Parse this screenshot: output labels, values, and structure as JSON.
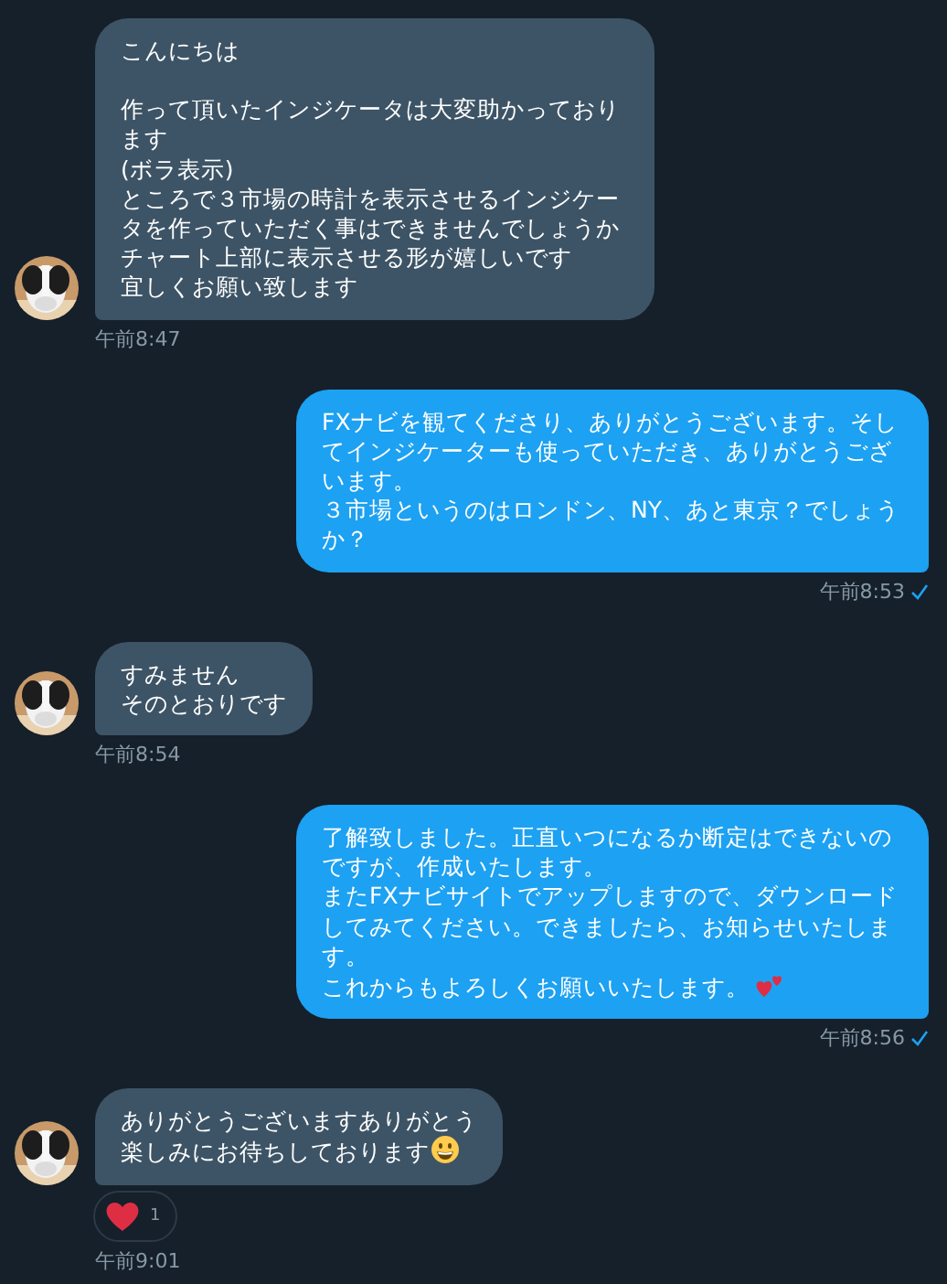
{
  "messages": [
    {
      "kind": "incoming",
      "paragraphs": [
        {
          "text": "こんにちは",
          "blank_after": true
        },
        {
          "text": "作って頂いたインジケータは大変助かっております"
        },
        {
          "text": "(ボラ表示)"
        },
        {
          "text": "ところで３市場の時計を表示させるインジケータを作っていただく事はできませんでしょうか"
        },
        {
          "text": "チャート上部に表示させる形が嬉しいです"
        },
        {
          "text": "宜しくお願い致します"
        }
      ],
      "time": "午前8:47",
      "avatar": {
        "kind": "picture"
      }
    },
    {
      "kind": "outgoing",
      "paragraphs": [
        {
          "text": "FXナビを観てくださり、ありがとうございます。そしてインジケーターも使っていただき、ありがとうございます。"
        },
        {
          "text": "３市場というのはロンドン、NY、あと東京？でしょうか？"
        }
      ],
      "time": "午前8:53",
      "read": true
    },
    {
      "kind": "incoming",
      "paragraphs": [
        {
          "text": "すみません"
        },
        {
          "text": "そのとおりです"
        }
      ],
      "time": "午前8:54",
      "avatar": {
        "kind": "picture"
      }
    },
    {
      "kind": "outgoing",
      "paragraphs": [
        {
          "text": "了解致しました。正直いつになるか断定はできないのですが、作成いたします。"
        },
        {
          "text": "またFXナビサイトでアップしますので、ダウンロードしてみてください。できましたら、お知らせいたします。"
        },
        {
          "text": "これからもよろしくお願いいたします。",
          "emoji": {
            "kind": "two-hearts"
          }
        }
      ],
      "time": "午前8:56",
      "read": true
    },
    {
      "kind": "incoming",
      "paragraphs": [
        {
          "text": "ありがとうございますありがとう"
        },
        {
          "text": "楽しみにお待ちしております",
          "emoji": {
            "kind": "grin"
          }
        }
      ],
      "time": "午前9:01",
      "avatar": {
        "kind": "picture"
      },
      "reaction": {
        "kind": "heart",
        "count": "1"
      }
    }
  ]
}
